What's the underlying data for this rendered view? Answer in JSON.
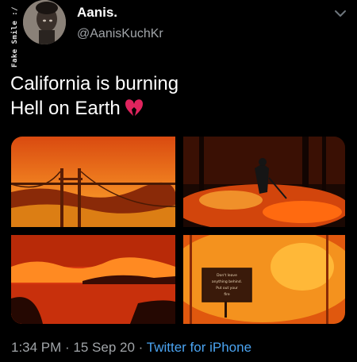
{
  "author": {
    "name": "Aanis.",
    "handle": "@AanisKuchKr",
    "avatar_banner_text": "Fake Smile :/"
  },
  "tweet": {
    "line1": "California is burning",
    "line2": "Hell on Earth",
    "emoji_icon": "broken-heart-icon"
  },
  "photos": [
    {
      "subject": "bridge-fire-photo"
    },
    {
      "subject": "firefighter-photo"
    },
    {
      "subject": "lake-fire-photo"
    },
    {
      "subject": "forest-sign-fire-photo",
      "sign_text": "Don't leave anything behind. Put out your fire"
    }
  ],
  "meta": {
    "time": "1:34 PM",
    "separator": " · ",
    "date": "15 Sep 20",
    "separator2": " · ",
    "source": "Twitter for iPhone"
  },
  "colors": {
    "background": "#000000",
    "secondary_text": "#a0a4a8",
    "link": "#4aa3f0",
    "heart": "#e0245e"
  }
}
